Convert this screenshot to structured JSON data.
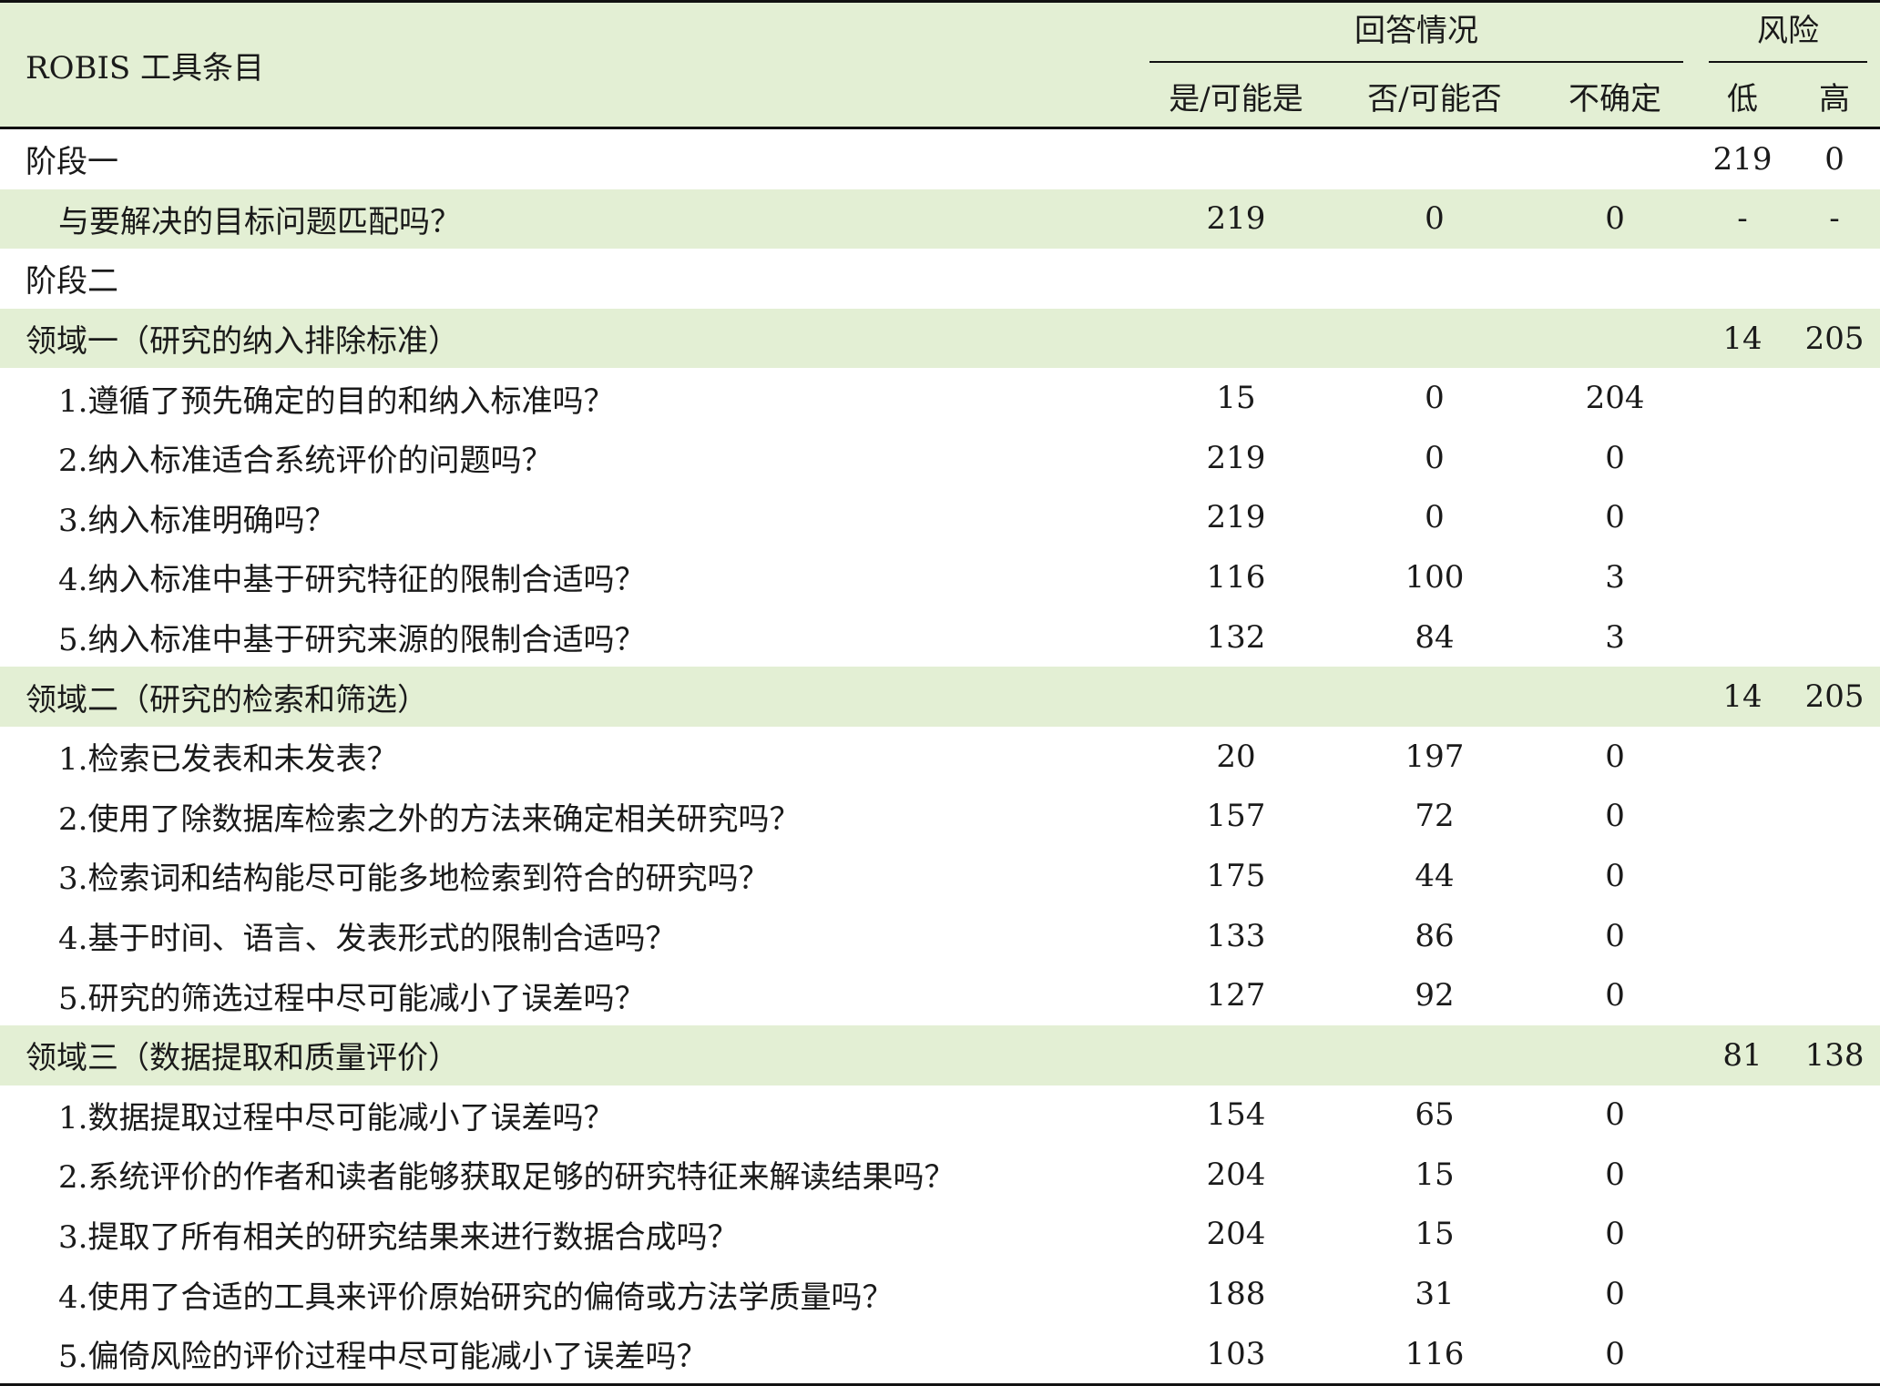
{
  "header": {
    "item_col": "ROBIS 工具条目",
    "response_group": "回答情况",
    "risk_group": "风险",
    "yes": "是/可能是",
    "no": "否/可能否",
    "unsure": "不确定",
    "low": "低",
    "high": "高"
  },
  "rows": [
    {
      "label": "阶段一",
      "yes": "",
      "no": "",
      "unsure": "",
      "low": "219",
      "high": "0",
      "shaded": false,
      "indent": false
    },
    {
      "label": "与要解决的目标问题匹配吗？",
      "yes": "219",
      "no": "0",
      "unsure": "0",
      "low": "-",
      "high": "-",
      "shaded": true,
      "indent": true
    },
    {
      "label": "阶段二",
      "yes": "",
      "no": "",
      "unsure": "",
      "low": "",
      "high": "",
      "shaded": false,
      "indent": false
    },
    {
      "label": "领域一（研究的纳入排除标准）",
      "yes": "",
      "no": "",
      "unsure": "",
      "low": "14",
      "high": "205",
      "shaded": true,
      "indent": false
    },
    {
      "label": "1.遵循了预先确定的目的和纳入标准吗？",
      "yes": "15",
      "no": "0",
      "unsure": "204",
      "low": "",
      "high": "",
      "shaded": false,
      "indent": true
    },
    {
      "label": "2.纳入标准适合系统评价的问题吗？",
      "yes": "219",
      "no": "0",
      "unsure": "0",
      "low": "",
      "high": "",
      "shaded": false,
      "indent": true
    },
    {
      "label": "3.纳入标准明确吗？",
      "yes": "219",
      "no": "0",
      "unsure": "0",
      "low": "",
      "high": "",
      "shaded": false,
      "indent": true
    },
    {
      "label": "4.纳入标准中基于研究特征的限制合适吗？",
      "yes": "116",
      "no": "100",
      "unsure": "3",
      "low": "",
      "high": "",
      "shaded": false,
      "indent": true
    },
    {
      "label": "5.纳入标准中基于研究来源的限制合适吗？",
      "yes": "132",
      "no": "84",
      "unsure": "3",
      "low": "",
      "high": "",
      "shaded": false,
      "indent": true
    },
    {
      "label": "领域二（研究的检索和筛选）",
      "yes": "",
      "no": "",
      "unsure": "",
      "low": "14",
      "high": "205",
      "shaded": true,
      "indent": false
    },
    {
      "label": "1.检索已发表和未发表？",
      "yes": "20",
      "no": "197",
      "unsure": "0",
      "low": "",
      "high": "",
      "shaded": false,
      "indent": true
    },
    {
      "label": "2.使用了除数据库检索之外的方法来确定相关研究吗？",
      "yes": "157",
      "no": "72",
      "unsure": "0",
      "low": "",
      "high": "",
      "shaded": false,
      "indent": true
    },
    {
      "label": "3.检索词和结构能尽可能多地检索到符合的研究吗？",
      "yes": "175",
      "no": "44",
      "unsure": "0",
      "low": "",
      "high": "",
      "shaded": false,
      "indent": true
    },
    {
      "label": "4.基于时间、语言、发表形式的限制合适吗？",
      "yes": "133",
      "no": "86",
      "unsure": "0",
      "low": "",
      "high": "",
      "shaded": false,
      "indent": true
    },
    {
      "label": "5.研究的筛选过程中尽可能减小了误差吗？",
      "yes": "127",
      "no": "92",
      "unsure": "0",
      "low": "",
      "high": "",
      "shaded": false,
      "indent": true
    },
    {
      "label": "领域三（数据提取和质量评价）",
      "yes": "",
      "no": "",
      "unsure": "",
      "low": "81",
      "high": "138",
      "shaded": true,
      "indent": false
    },
    {
      "label": "1.数据提取过程中尽可能减小了误差吗？",
      "yes": "154",
      "no": "65",
      "unsure": "0",
      "low": "",
      "high": "",
      "shaded": false,
      "indent": true
    },
    {
      "label": "2.系统评价的作者和读者能够获取足够的研究特征来解读结果吗？",
      "yes": "204",
      "no": "15",
      "unsure": "0",
      "low": "",
      "high": "",
      "shaded": false,
      "indent": true
    },
    {
      "label": "3.提取了所有相关的研究结果来进行数据合成吗？",
      "yes": "204",
      "no": "15",
      "unsure": "0",
      "low": "",
      "high": "",
      "shaded": false,
      "indent": true
    },
    {
      "label": "4.使用了合适的工具来评价原始研究的偏倚或方法学质量吗？",
      "yes": "188",
      "no": "31",
      "unsure": "0",
      "low": "",
      "high": "",
      "shaded": false,
      "indent": true
    },
    {
      "label": "5.偏倚风险的评价过程中尽可能减小了误差吗？",
      "yes": "103",
      "no": "116",
      "unsure": "0",
      "low": "",
      "high": "",
      "shaded": false,
      "indent": true
    }
  ]
}
